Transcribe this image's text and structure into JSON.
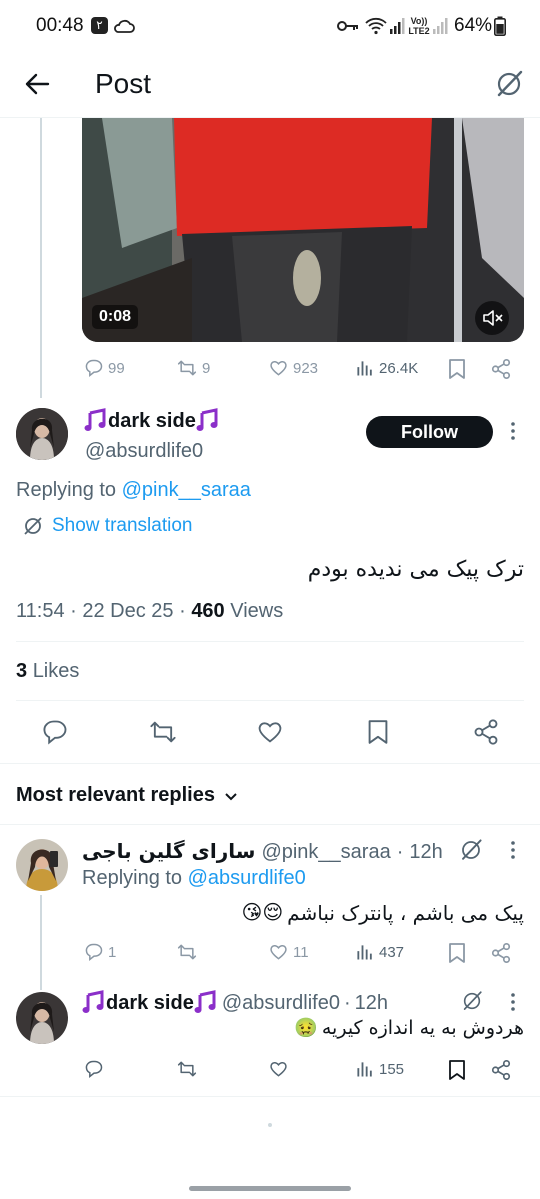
{
  "status_bar": {
    "time": "00:48",
    "sim_badge": "۲",
    "lte_label": "Vo)) LTE2",
    "battery": "64%"
  },
  "header": {
    "title": "Post"
  },
  "video": {
    "duration": "0:08"
  },
  "parent_actions": {
    "replies": "99",
    "reposts": "9",
    "likes": "923",
    "views": "26.4K"
  },
  "main_post": {
    "display_name": "dark side",
    "handle": "@absurdlife0",
    "follow_label": "Follow",
    "replying_prefix": "Replying to",
    "replying_handle": "@pink__saraa",
    "show_translation": "Show translation",
    "text": "ترک پیک می ندیده بودم",
    "time": "11:54",
    "date": "22 Dec 25",
    "views_count": "460",
    "views_label": "Views",
    "likes_count": "3",
    "likes_label": "Likes"
  },
  "replies_header": {
    "label": "Most relevant replies"
  },
  "replies": [
    {
      "display_name": "سارای گلین باجی",
      "handle": "@pink__saraa",
      "age": "12h",
      "replying_prefix": "Replying to",
      "replying_handle": "@absurdlife0",
      "text": "پیک می باشم ، پانترک نباشم",
      "emoji": "😘😌",
      "replies": "1",
      "reposts": "",
      "likes": "11",
      "views": "437"
    },
    {
      "display_name": "dark side",
      "handle": "@absurdlife0",
      "age": "12h",
      "text": "هردوش به یه اندازه کیریه",
      "emoji": "🤢",
      "replies": "",
      "reposts": "",
      "likes": "",
      "views": "155"
    }
  ],
  "colors": {
    "link": "#1d9bf0",
    "muted": "#536471",
    "follow_bg": "#0f1419",
    "thread_line": "#cfd9de",
    "note_purple": "#8b2fc9"
  },
  "icons": [
    "back-arrow-icon",
    "grok-slash-icon",
    "reply-icon",
    "repost-icon",
    "like-icon",
    "views-icon",
    "bookmark-icon",
    "share-icon",
    "more-icon",
    "translate-icon",
    "mute-icon",
    "chevron-down-icon",
    "music-note-icon"
  ]
}
